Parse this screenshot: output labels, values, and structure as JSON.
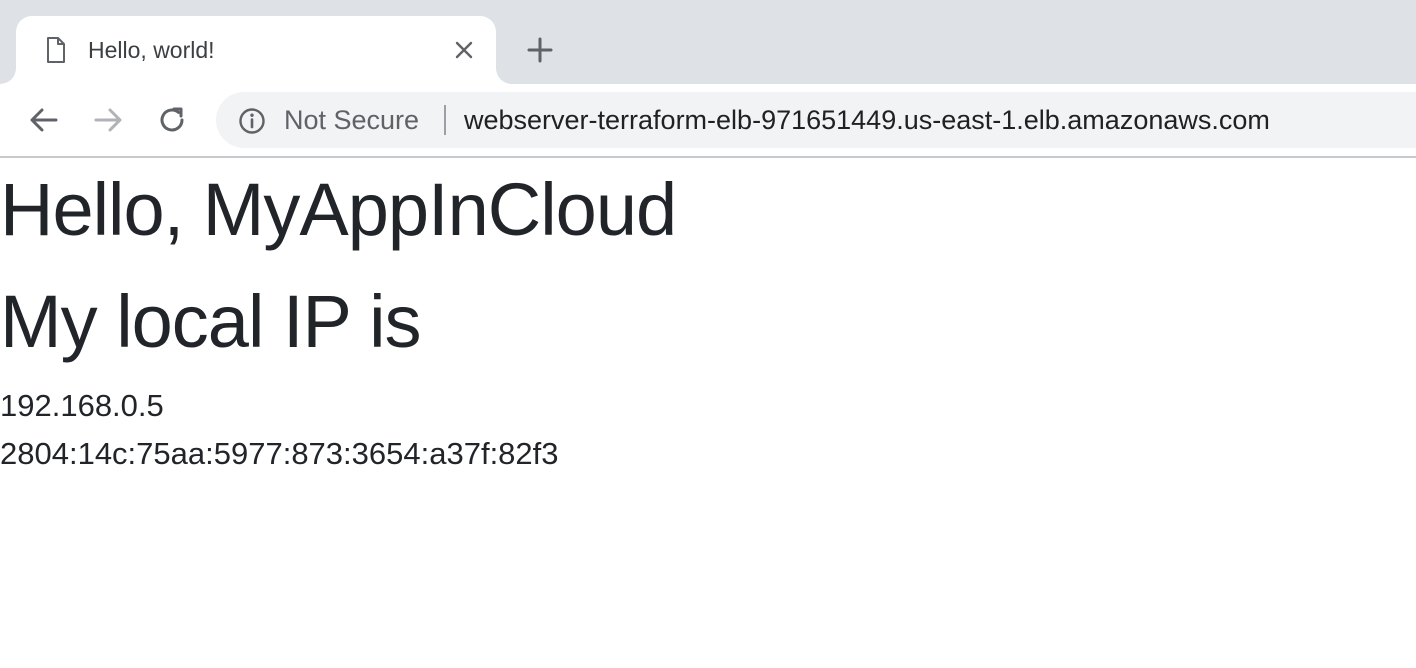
{
  "tab": {
    "title": "Hello, world!",
    "favicon_icon": "document-icon",
    "close_icon": "close-icon"
  },
  "new_tab_icon": "plus-icon",
  "toolbar": {
    "back_icon": "back-arrow-icon",
    "forward_icon": "forward-arrow-icon",
    "reload_icon": "reload-icon",
    "omnibox": {
      "security_icon": "info-icon",
      "security_label": "Not Secure",
      "url": "webserver-terraform-elb-971651449.us-east-1.elb.amazonaws.com"
    }
  },
  "page": {
    "heading_hello": "Hello, MyAppInCloud",
    "heading_ip": "My local IP is",
    "ips": [
      "192.168.0.5",
      "2804:14c:75aa:5977:873:3654:a37f:82f3"
    ]
  },
  "colors": {
    "tabstrip_bg": "#dee1e6",
    "omnibox_bg": "#f1f3f4",
    "text_dark": "#212529",
    "icon_gray": "#5f6368",
    "forward_disabled": "#b1b3b6"
  }
}
